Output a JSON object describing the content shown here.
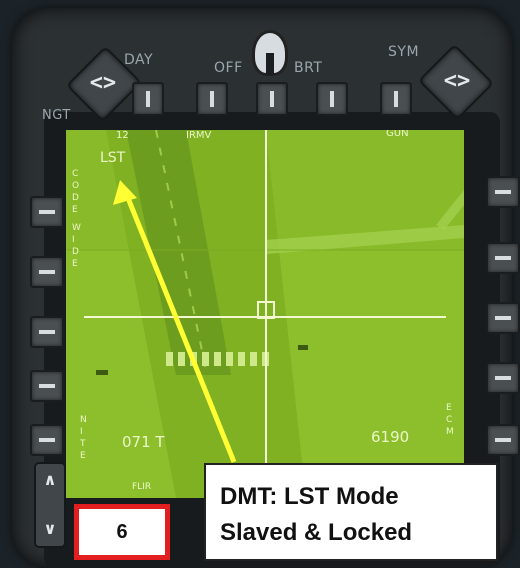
{
  "bezel": {
    "day_label": "DAY",
    "ngt_label": "NGT",
    "brightness_off_label": "OFF",
    "brightness_brt_label": "BRT",
    "sym_label": "SYM",
    "left_rocker_glyph": "<>",
    "right_rocker_glyph": "<>",
    "vertical_rocker_up": "∧",
    "vertical_rocker_down": "∨"
  },
  "mfd": {
    "top_left_number": "12",
    "top_irmv": "IRMV",
    "top_gun": "GUN",
    "mode_lst": "LST",
    "left_side_code": "C\nO\nD\nE",
    "left_side_wide": "W\nI\nD\nE",
    "left_side_nite": "N\nI\nT\nE",
    "right_side_ecm": "E\nC\nM",
    "heading": "071 T",
    "range": "6190",
    "bottom_flir": "FLIR"
  },
  "annotation": {
    "callout_line1": "DMT: LST Mode",
    "callout_line2": "Slaved & Locked",
    "step_number": "6",
    "arrow_color": "#ffff33",
    "step_border_color": "#e31e1e"
  }
}
